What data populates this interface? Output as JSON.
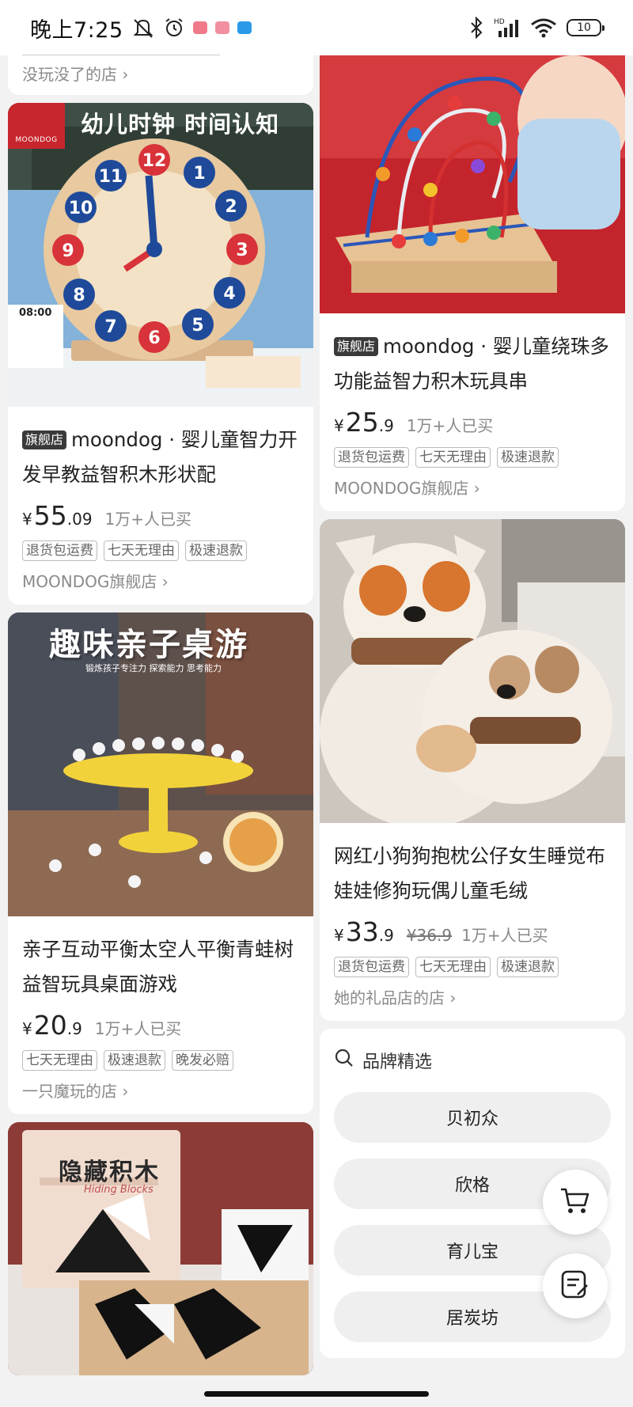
{
  "status_bar": {
    "time": "晚上7:25",
    "battery": "10",
    "network": "HD"
  },
  "left_column": {
    "prev_card_shop": "没玩没了的店",
    "cards": [
      {
        "image_caption": "幼儿时钟 时间认知",
        "image_brand": "MOONDOG",
        "image_card_time": "08:00",
        "badge": "旗舰店",
        "title": "moondog · 婴儿童智力开发早教益智积木形状配",
        "price_int": "55",
        "price_dec": ".09",
        "sold": "1万+人已买",
        "tags": [
          "退货包运费",
          "七天无理由",
          "极速退款"
        ],
        "shop": "MOONDOG旗舰店"
      },
      {
        "image_caption": "趣味亲子桌游",
        "image_subcaption": "锻炼孩子专注力 探索能力 思考能力",
        "title": "亲子互动平衡太空人平衡青蛙树益智玩具桌面游戏",
        "price_int": "20",
        "price_dec": ".9",
        "sold": "1万+人已买",
        "tags": [
          "七天无理由",
          "极速退款",
          "晚发必赔"
        ],
        "shop": "一只魔玩的店"
      },
      {
        "image_caption": "隐藏积木",
        "image_subcaption": "Hiding Blocks"
      }
    ]
  },
  "right_column": {
    "cards": [
      {
        "badge": "旗舰店",
        "title": "moondog · 婴儿童绕珠多功能益智力积木玩具串",
        "price_int": "25",
        "price_dec": ".9",
        "sold": "1万+人已买",
        "tags": [
          "退货包运费",
          "七天无理由",
          "极速退款"
        ],
        "shop": "MOONDOG旗舰店"
      },
      {
        "title": "网红小狗狗抱枕公仔女生睡觉布娃娃修狗玩偶儿童毛绒",
        "price_int": "33",
        "price_dec": ".9",
        "price_old": "¥36.9",
        "sold": "1万+人已买",
        "tags": [
          "退货包运费",
          "七天无理由",
          "极速退款"
        ],
        "shop": "她的礼品店的店"
      }
    ],
    "brand_section": {
      "title": "品牌精选",
      "brands": [
        "贝初众",
        "欣格",
        "育儿宝",
        "居炭坊"
      ]
    }
  },
  "currency": "¥",
  "icons": {
    "search": "search-icon",
    "cart": "cart-icon",
    "list": "list-edit-icon"
  }
}
